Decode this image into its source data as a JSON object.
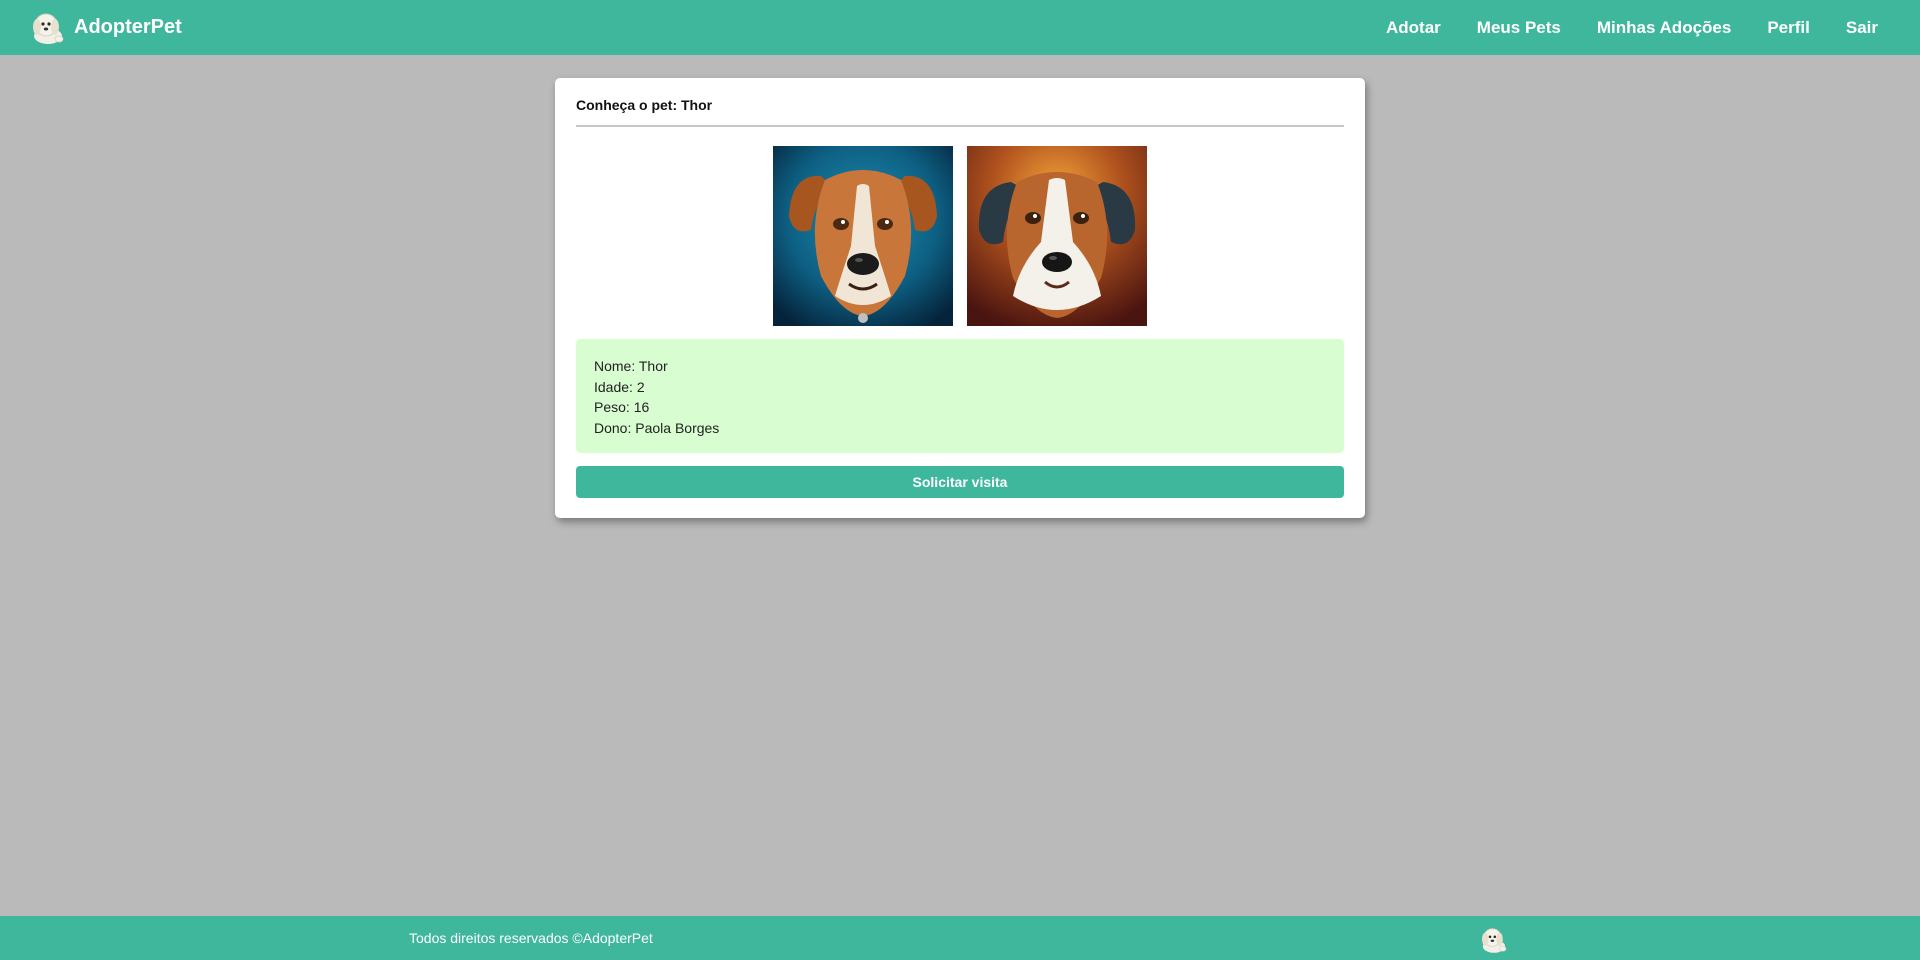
{
  "brand": {
    "name": "AdopterPet",
    "logo_icon": "puppy-logo-icon"
  },
  "nav": {
    "items": [
      {
        "label": "Adotar"
      },
      {
        "label": "Meus Pets"
      },
      {
        "label": "Minhas Adoções"
      },
      {
        "label": "Perfil"
      },
      {
        "label": "Sair"
      }
    ]
  },
  "pet": {
    "title": "Conheça o pet: Thor",
    "photos": [
      "dog-portrait-blue-background",
      "dog-portrait-orange-background"
    ],
    "details": [
      "Nome: Thor",
      "Idade: 2",
      "Peso: 16",
      "Dono: Paola Borges"
    ],
    "action_label": "Solicitar visita"
  },
  "footer": {
    "text": "Todos direitos reservados ©AdopterPet",
    "logo_icon": "puppy-logo-icon"
  },
  "colors": {
    "primary": "#3eb79d",
    "background": "#bababa",
    "info_bg": "#d8fdd0"
  }
}
